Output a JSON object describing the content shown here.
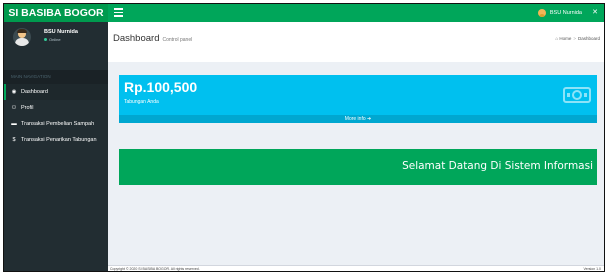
{
  "app": {
    "brand": "SI BASIBA BOGOR"
  },
  "header": {
    "toggle_icon": "hamburger-icon",
    "user_name": "BSU Nurnida",
    "share_icon": "share-alt-icon"
  },
  "sidebar": {
    "user_name": "BSU Nurnida",
    "user_status": "Online",
    "nav_header": "MAIN NAVIGATION",
    "items": [
      {
        "icon": "dashboard-icon",
        "glyph": "◉",
        "label": "Dashboard"
      },
      {
        "icon": "users-icon",
        "glyph": "⚇",
        "label": "Profil"
      },
      {
        "icon": "trash-icon",
        "glyph": "▬",
        "label": "Transaksi Pembelian Sampah"
      },
      {
        "icon": "dollar-icon",
        "glyph": "$",
        "label": "Transaksi Penarikan Tabungan"
      }
    ]
  },
  "content_header": {
    "title": "Dashboard",
    "subtitle": "Control panel",
    "breadcrumb_home": "Home",
    "breadcrumb_current": "Dashboard"
  },
  "stat_box": {
    "value": "Rp.100,500",
    "label": "Tabungan Anda",
    "footer_label": "More info",
    "icon": "money-icon",
    "color": "#00c0ef"
  },
  "welcome": {
    "text": "Selamat Datang Di Sistem Informasi",
    "color": "#00a65a"
  },
  "footer": {
    "copyright": "Copyright © 2020 SI BASIBA BOGOR. All rights reserved.",
    "version": "Version 1.0"
  }
}
